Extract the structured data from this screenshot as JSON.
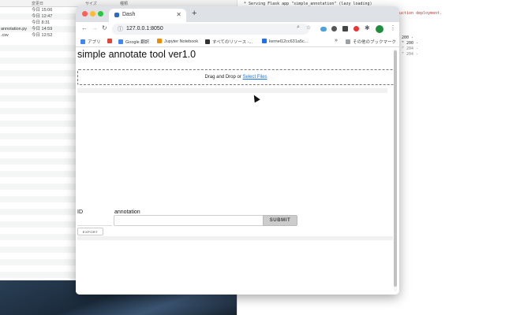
{
  "finder": {
    "headers": {
      "size": "サイズ",
      "kind": "種類",
      "modified": "変更日"
    },
    "rows": [
      {
        "name": "",
        "date": "今日 15:06"
      },
      {
        "name": "",
        "date": "今日 12:47"
      },
      {
        "name": "",
        "date": "今日 8:31"
      },
      {
        "name": "annotation.py",
        "date": "今日 14:59"
      },
      {
        "name": ".csv",
        "date": "今日 12:52"
      }
    ]
  },
  "terminal": {
    "lines": [
      "* Serving Flask app \"simple_annotation\" (lazy loading)",
      "uction deployment.",
      "200 -",
      "\" 200 -",
      "\" 204 -",
      "\" 204 -"
    ]
  },
  "browser": {
    "tab_title": "Dash",
    "url": "127.0.0.1:8050",
    "bookmarks": [
      "アプリ",
      "Google 翻訳",
      "Jupyter Notebook",
      "すべてのリソース -...",
      "kernel12cc631a5c...",
      "その他のブックマーク"
    ],
    "bookmark_colors": [
      "#4285f4",
      "#ea4335",
      "#4285f4",
      "#f28b00",
      "#333333",
      "#1f6feb",
      "#9aa0a6"
    ],
    "more_bookmarks_glyph": "»"
  },
  "page": {
    "title": "simple annotate tool ver1.0",
    "dropzone_prefix": "Drag and Drop or ",
    "dropzone_link": "Select Files",
    "id_label": "ID",
    "annotation_label": "annotation",
    "id_value": "",
    "annotation_value": "",
    "submit_label": "SUBMIT",
    "export_label": "EXPORT"
  },
  "colors": {
    "accent": "#1a73e8",
    "tab_bar": "#dee1e6",
    "submit_bg": "#cccccc"
  }
}
